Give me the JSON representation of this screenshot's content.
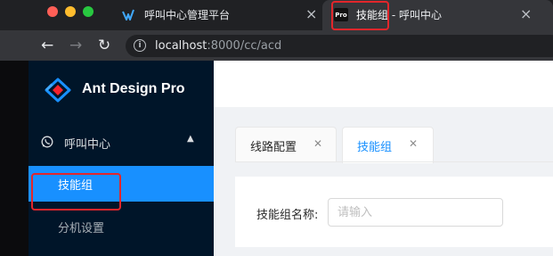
{
  "browser": {
    "tabs": [
      {
        "title": "呼叫中心管理平台",
        "active": false
      },
      {
        "title_highlight": "技能组",
        "title_rest": " - 呼叫中心",
        "favicon_text": "Pro",
        "active": true
      }
    ],
    "url": {
      "host": "localhost",
      "rest": ":8000/cc/acd"
    }
  },
  "sidebar": {
    "brand": "Ant Design Pro",
    "submenu": {
      "title": "呼叫中心",
      "icon": "whatsapp-icon",
      "expanded": true
    },
    "items": [
      {
        "label": "技能组",
        "active": true
      },
      {
        "label": "分机设置",
        "active": false
      }
    ]
  },
  "content": {
    "tabs": [
      {
        "label": "线路配置",
        "active": false
      },
      {
        "label": "技能组",
        "active": true
      }
    ],
    "form": {
      "label": "技能组名称:",
      "placeholder": "请输入"
    }
  },
  "colors": {
    "primary": "#1890ff",
    "sidebar_bg": "#001529",
    "highlight_red": "#e3262b"
  }
}
